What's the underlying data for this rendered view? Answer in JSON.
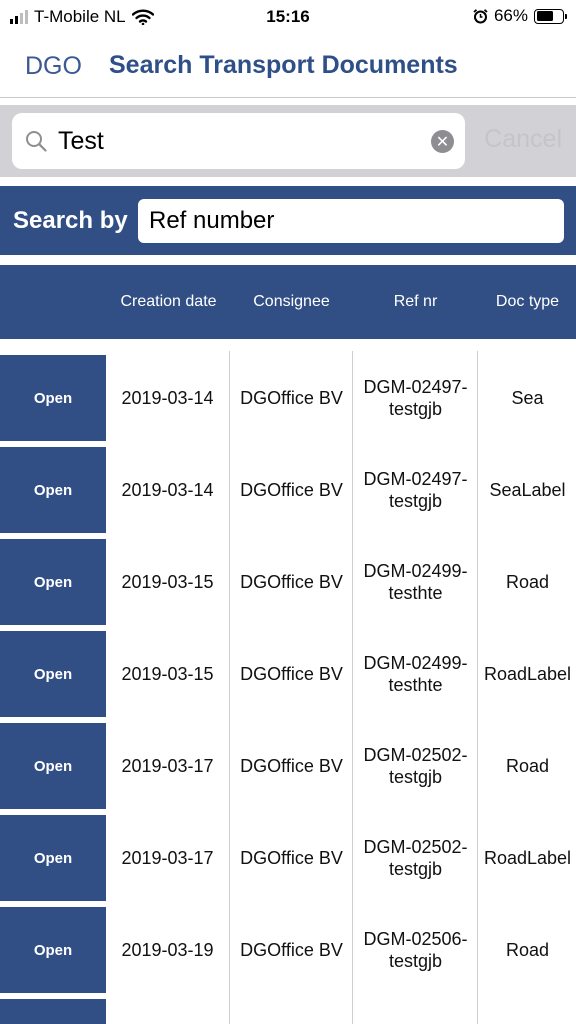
{
  "status_bar": {
    "carrier": "T-Mobile NL",
    "time": "15:16",
    "battery_percent": "66%",
    "battery_level": 0.66
  },
  "nav": {
    "back_label": "DGO",
    "title": "Search Transport Documents"
  },
  "search": {
    "query": "Test",
    "cancel_label": "Cancel"
  },
  "search_by": {
    "label": "Search by",
    "value": "Ref number"
  },
  "table": {
    "headers": {
      "creation_date": "Creation date",
      "consignee": "Consignee",
      "ref_nr": "Ref nr",
      "doc_type": "Doc type"
    },
    "open_label": "Open",
    "rows": [
      {
        "date": "2019-03-14",
        "consignee": "DGOffice BV",
        "ref": "DGM-02497-testgjb",
        "doc_type": "Sea"
      },
      {
        "date": "2019-03-14",
        "consignee": "DGOffice BV",
        "ref": "DGM-02497-testgjb",
        "doc_type": "SeaLabel"
      },
      {
        "date": "2019-03-15",
        "consignee": "DGOffice BV",
        "ref": "DGM-02499-testhte",
        "doc_type": "Road"
      },
      {
        "date": "2019-03-15",
        "consignee": "DGOffice BV",
        "ref": "DGM-02499-testhte",
        "doc_type": "RoadLabel"
      },
      {
        "date": "2019-03-17",
        "consignee": "DGOffice BV",
        "ref": "DGM-02502-testgjb",
        "doc_type": "Road"
      },
      {
        "date": "2019-03-17",
        "consignee": "DGOffice BV",
        "ref": "DGM-02502-testgjb",
        "doc_type": "RoadLabel"
      },
      {
        "date": "2019-03-19",
        "consignee": "DGOffice BV",
        "ref": "DGM-02506-testgjb",
        "doc_type": "Road"
      }
    ]
  },
  "colors": {
    "primary": "#324f85",
    "nav_title": "#2f4f88"
  }
}
